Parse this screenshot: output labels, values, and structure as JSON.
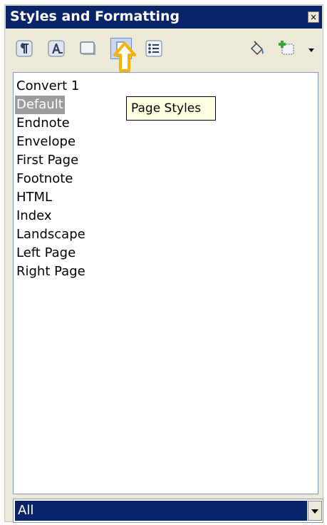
{
  "panel": {
    "title": "Styles and Formatting",
    "close_glyph": "×"
  },
  "toolbar": {
    "buttons": [
      {
        "icon": "paragraph-styles-icon"
      },
      {
        "icon": "character-styles-icon"
      },
      {
        "icon": "frame-styles-icon"
      },
      {
        "icon": "page-styles-icon",
        "active": true
      },
      {
        "icon": "list-styles-icon"
      },
      {
        "icon": "fill-format-mode-icon"
      },
      {
        "icon": "new-style-from-selection-icon"
      }
    ]
  },
  "tooltip": {
    "text": "Page Styles"
  },
  "styles_list": {
    "items": [
      "Convert 1",
      "Default",
      "Endnote",
      "Envelope",
      "First Page",
      "Footnote",
      "HTML",
      "Index",
      "Landscape",
      "Left Page",
      "Right Page"
    ],
    "selected": "Default"
  },
  "filter": {
    "value": "All"
  },
  "colors": {
    "title_bar": "#0a246a",
    "panel_bg": "#ece9d8",
    "highlight_arrow": "#f4b400",
    "tooltip_bg": "#ffffe1"
  }
}
